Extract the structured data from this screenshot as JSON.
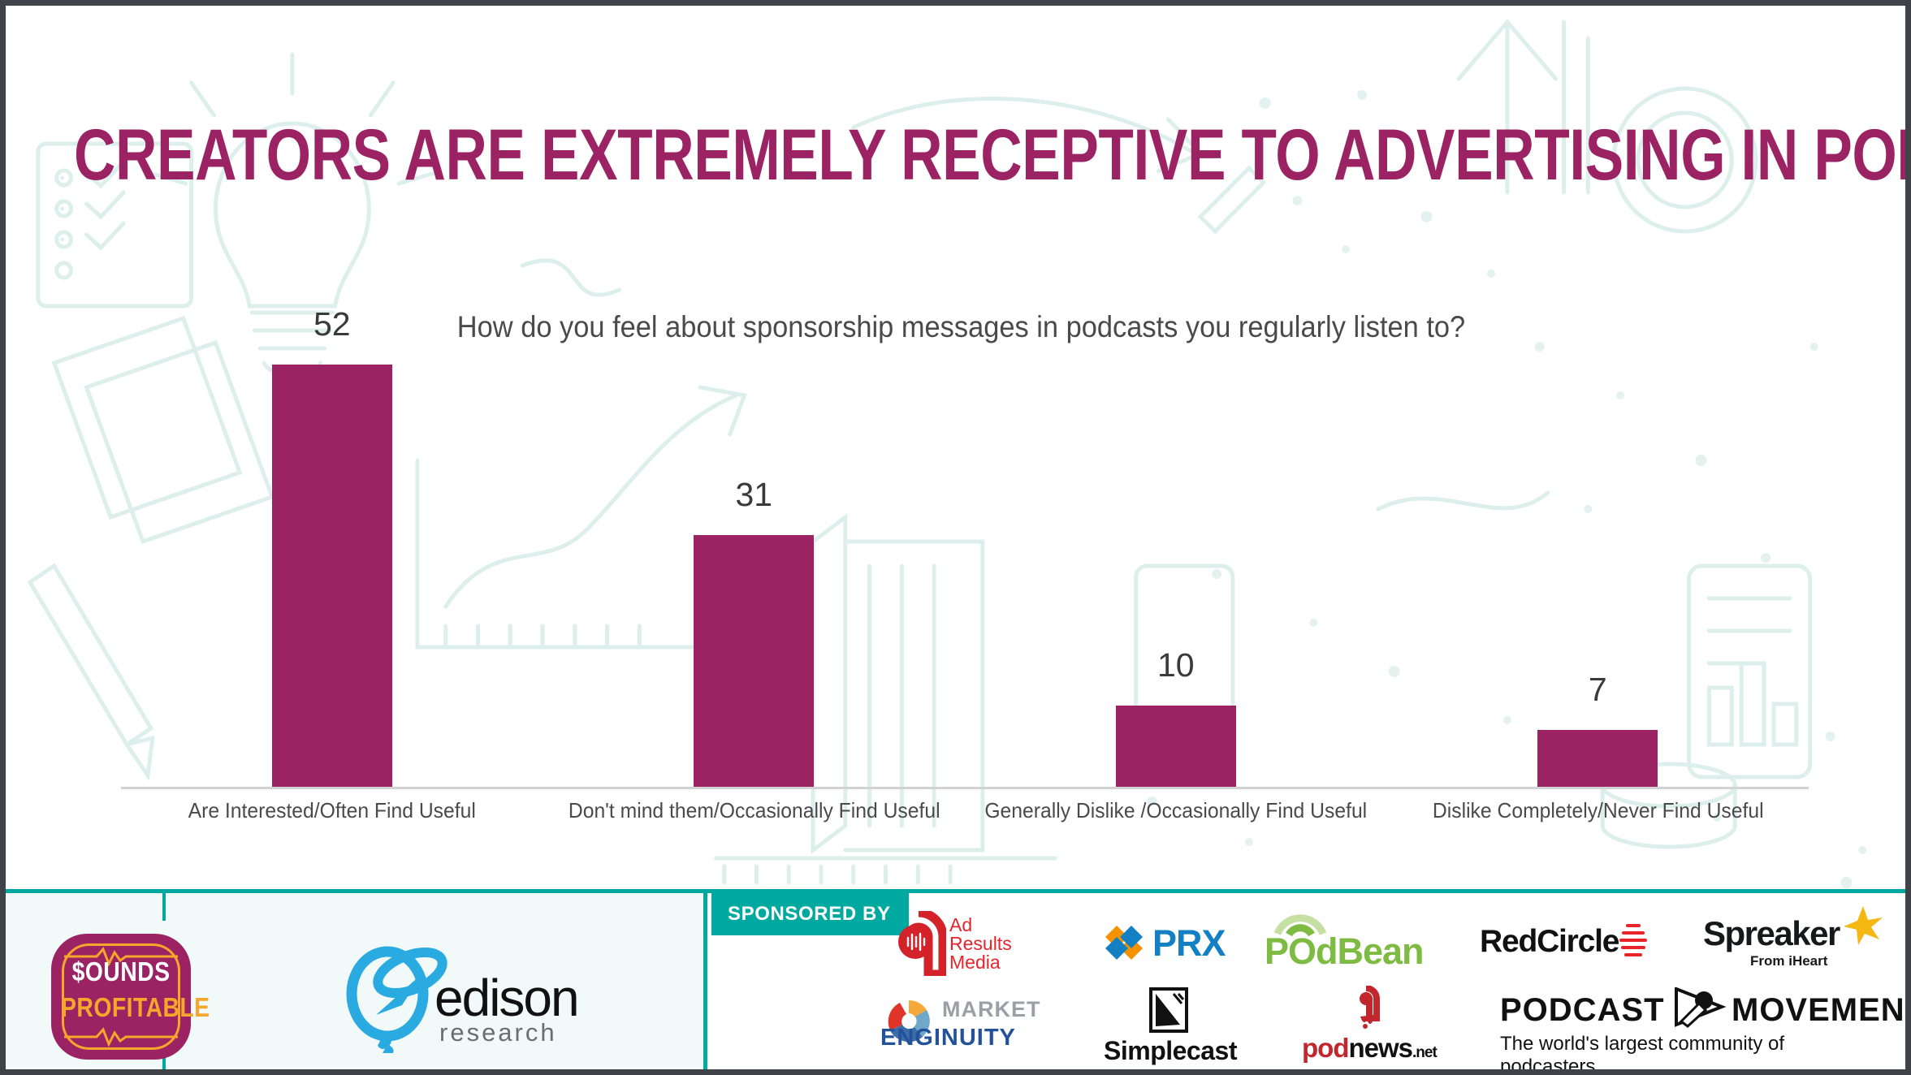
{
  "slide": {
    "title": "CREATORS ARE EXTREMELY RECEPTIVE TO ADVERTISING IN PODCASTS",
    "title_color": "#9B2263",
    "border_color": "#3f4246",
    "accent_teal": "#00A9A0"
  },
  "chart_data": {
    "type": "bar",
    "title": "How do you feel about sponsorship messages in podcasts you regularly listen to?",
    "categories": [
      "Are Interested/Often Find Useful",
      "Don't mind them/Occasionally Find Useful",
      "Generally Dislike /Occasionally Find Useful",
      "Dislike Completely/Never Find Useful"
    ],
    "values": [
      52,
      31,
      10,
      7
    ],
    "value_labels": [
      "52",
      "31",
      "10",
      "7"
    ],
    "xlabel": "",
    "ylabel": "",
    "ylim": [
      0,
      62
    ],
    "grid": false,
    "legend": "none",
    "bar_color": "#9B2263",
    "axis_color": "#d2d2d2"
  },
  "footer": {
    "sounds_profitable": {
      "line1": "$OUNDS",
      "line2": "PROFITABLE",
      "bg": "#9B2263",
      "accent": "#F5A72B"
    },
    "edison": {
      "word": "edison",
      "sub": "research",
      "mark_color": "#29ABE2"
    },
    "sponsored_by_label": "SPONSORED BY",
    "sponsors_row1": [
      {
        "name": "ad-results-media",
        "line1": "Ad",
        "line2": "Results",
        "line3": "Media",
        "color": "#E8242A"
      },
      {
        "name": "prx",
        "text": "PRX",
        "color": "#1380C3"
      },
      {
        "name": "podbean",
        "text": "POdBean",
        "color": "#7DBB42"
      },
      {
        "name": "redcircle",
        "text": "RedCircle",
        "color": "#111111"
      },
      {
        "name": "spreaker",
        "text": "Spreaker",
        "sub": "From iHeart",
        "color": "#17181c"
      }
    ],
    "sponsors_row2": [
      {
        "name": "market-enginuity",
        "line1": "MARKET",
        "line2": "ENGINUITY",
        "color": "#23529B"
      },
      {
        "name": "simplecast",
        "text": "Simplecast",
        "color": "#111111"
      },
      {
        "name": "podnews",
        "text_a": "pod",
        "text_b": "news",
        "text_c": ".net",
        "color": "#C1272D"
      },
      {
        "name": "podcast-movement",
        "word1": "PODCAST",
        "word2": "MOVEMENT",
        "tagline": "The world's largest community of podcasters."
      }
    ]
  }
}
